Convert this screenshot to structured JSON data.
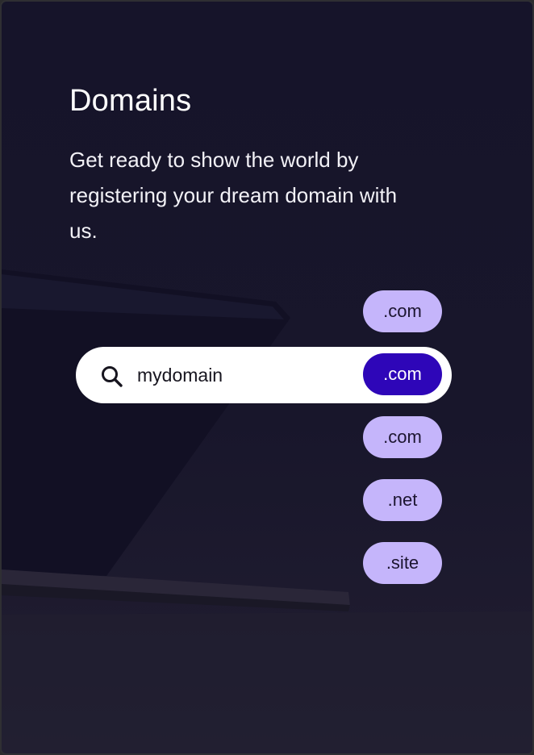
{
  "card": {
    "title": "Domains",
    "description": "Get ready to show the world by registering your dream domain with us."
  },
  "search": {
    "icon": "search-icon",
    "value": "mydomain",
    "placeholder": "mydomain"
  },
  "extensions": [
    {
      "label": ".com",
      "selected": false
    },
    {
      "label": ".com",
      "selected": true
    },
    {
      "label": ".com",
      "selected": false
    },
    {
      "label": ".net",
      "selected": false
    },
    {
      "label": ".site",
      "selected": false
    }
  ],
  "colors": {
    "background": "#16142a",
    "pill": "#c5b5fb",
    "pill_selected": "#2e06b8",
    "search_bg": "#ffffff"
  }
}
